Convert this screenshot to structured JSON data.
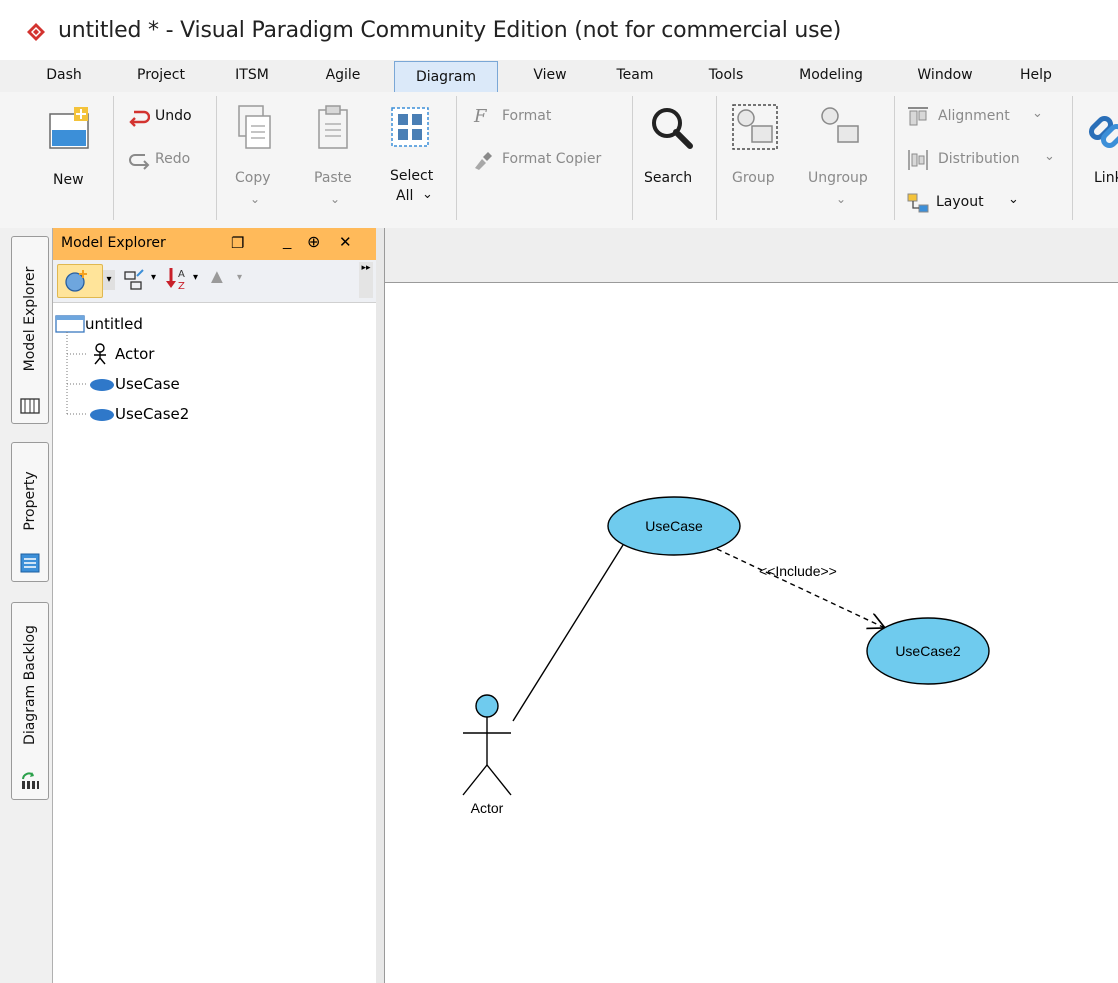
{
  "window": {
    "title": "untitled * - Visual Paradigm Community Edition (not for commercial use)"
  },
  "menu": {
    "items": [
      "Dash",
      "Project",
      "ITSM",
      "Agile",
      "Diagram",
      "View",
      "Team",
      "Tools",
      "Modeling",
      "Window",
      "Help"
    ],
    "active": "Diagram"
  },
  "ribbon": {
    "new": "New",
    "undo": "Undo",
    "redo": "Redo",
    "copy": "Copy",
    "paste": "Paste",
    "select_all_1": "Select",
    "select_all_2": "All",
    "format": "Format",
    "format_copier": "Format Copier",
    "search": "Search",
    "group": "Group",
    "ungroup": "Ungroup",
    "alignment": "Alignment",
    "distribution": "Distribution",
    "layout": "Layout",
    "link": "Link"
  },
  "side_tabs": {
    "model_explorer": "Model Explorer",
    "property": "Property",
    "diagram_backlog": "Diagram Backlog"
  },
  "explorer": {
    "title": "Model Explorer",
    "root": "untitled",
    "items": [
      {
        "label": "Actor",
        "icon": "actor-icon"
      },
      {
        "label": "UseCase",
        "icon": "usecase-icon"
      },
      {
        "label": "UseCase2",
        "icon": "usecase-icon"
      }
    ]
  },
  "diagram": {
    "usecase1": "UseCase",
    "usecase2": "UseCase2",
    "actor": "Actor",
    "include_label": "<<Include>>"
  },
  "colors": {
    "usecase_fill": "#6fcbee",
    "explorer_header": "#ffba5a",
    "active_menu": "#dbe9f9",
    "brand_icon": "#d3332f"
  }
}
